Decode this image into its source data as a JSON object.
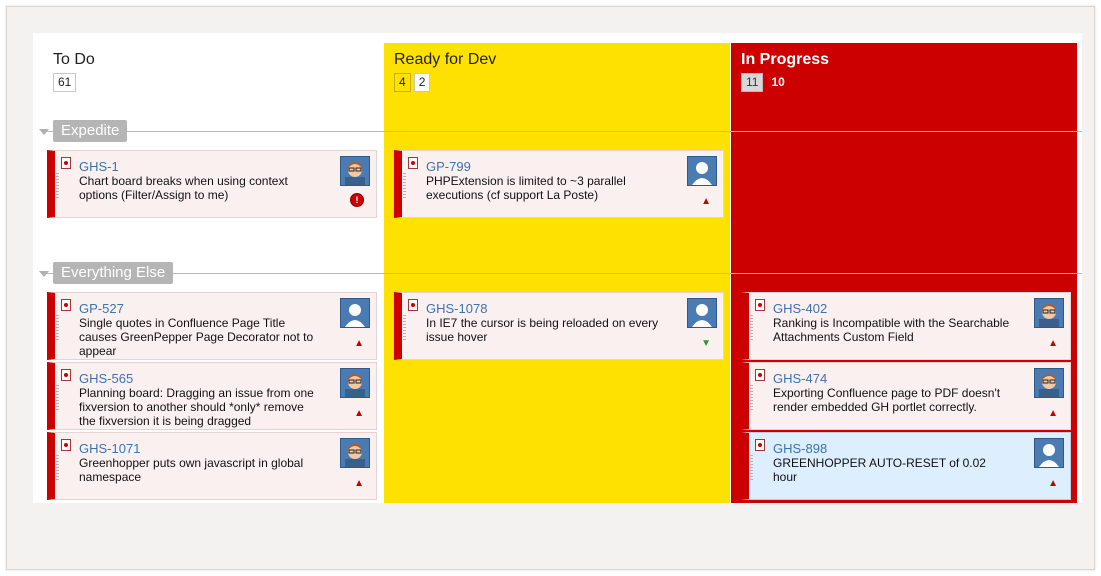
{
  "columns": [
    {
      "title": "To Do",
      "badges": [
        "61"
      ]
    },
    {
      "title": "Ready for Dev",
      "badges": [
        "4",
        "2"
      ]
    },
    {
      "title": "In Progress",
      "badges": [
        "11",
        "10"
      ]
    }
  ],
  "swimlanes": [
    {
      "label": "Expedite"
    },
    {
      "label": "Everything Else"
    }
  ],
  "cards": {
    "expedite_todo": [
      {
        "key": "GHS-1",
        "summary": "Chart board breaks when using context options (Filter/Assign to me)",
        "avatar": "person-avatar-icon",
        "priority": "blocker-icon"
      }
    ],
    "expedite_ready": [
      {
        "key": "GP-799",
        "summary": "PHPExtension is limited to ~3 parallel executions (cf support La Poste)",
        "avatar": "default-avatar-icon",
        "priority": "priority-up-icon"
      }
    ],
    "else_todo": [
      {
        "key": "GP-527",
        "summary": "Single quotes in Confluence Page Title causes GreenPepper Page Decorator not to appear",
        "avatar": "default-avatar-icon",
        "priority": "priority-up-icon"
      },
      {
        "key": "GHS-565",
        "summary": "Planning board: Dragging an issue from one fixversion to another should *only* remove the fixversion it is being dragged",
        "avatar": "person-avatar-icon",
        "priority": "priority-up-icon"
      },
      {
        "key": "GHS-1071",
        "summary": "Greenhopper puts own javascript in global namespace",
        "avatar": "person-avatar-icon",
        "priority": "priority-up-icon"
      }
    ],
    "else_ready": [
      {
        "key": "GHS-1078",
        "summary": "In IE7 the cursor is being reloaded on every issue hover",
        "avatar": "default-avatar-icon",
        "priority": "priority-down-icon"
      }
    ],
    "else_prog": [
      {
        "key": "GHS-402",
        "summary": "Ranking is Incompatible with the Searchable Attachments Custom Field",
        "avatar": "person-avatar-icon",
        "priority": "priority-up-icon"
      },
      {
        "key": "GHS-474",
        "summary": "Exporting Confluence page to PDF doesn't render embedded GH portlet correctly.",
        "avatar": "person-avatar-icon",
        "priority": "priority-up-icon"
      },
      {
        "key": "GHS-898",
        "summary": "GREENHOPPER AUTO-RESET of 0.02 hour",
        "avatar": "default-avatar-icon",
        "priority": "priority-up-icon"
      }
    ]
  },
  "colors": {
    "ready_column": "#ffe100",
    "in_progress_column": "#cc0000",
    "link": "#3b73af",
    "card_bg": "#fbf0f0",
    "selected_card_bg": "#ddeeff"
  }
}
